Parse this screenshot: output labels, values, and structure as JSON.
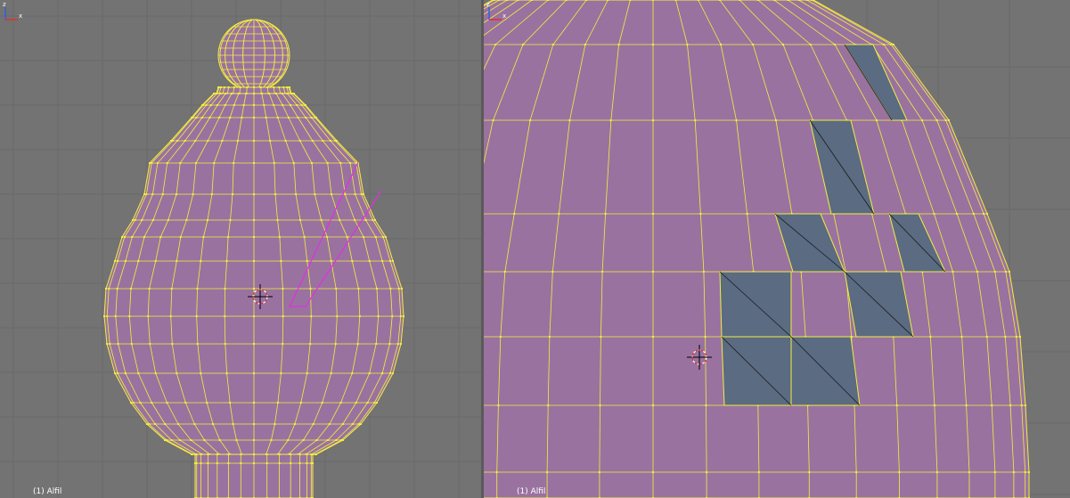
{
  "viewports": [
    {
      "id": "left",
      "object_label": "(1) Alfil",
      "view": "front-wireframe-full"
    },
    {
      "id": "right",
      "object_label": "(1) Alfil",
      "view": "front-wireframe-zoomed"
    }
  ],
  "axis": {
    "x_label": "x",
    "z_label": "z"
  },
  "colors": {
    "background": "#737373",
    "grid": "#6a6a6a",
    "mesh_face": "#9a72a0",
    "mesh_edge": "#f2ef3c",
    "selected_face": "#5a6b82",
    "knife_line": "#e030e0",
    "axis_x": "#e03030",
    "axis_z": "#3060e0"
  },
  "icons": [
    "3d-cursor-icon",
    "axis-gizmo-icon"
  ]
}
